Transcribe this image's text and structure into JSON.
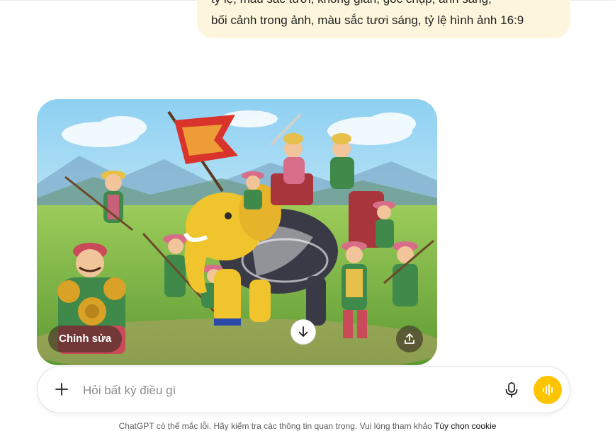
{
  "chat": {
    "user_message_line1": "tỷ lệ, màu sắc tươi, không gian, góc chụp, ánh sáng,",
    "user_message_line2": "bối cảnh trong ảnh, màu sắc tươi sáng, tỷ lệ hình ảnh 16:9"
  },
  "image_actions": {
    "edit_label": "Chỉnh sửa"
  },
  "composer": {
    "placeholder": "Hỏi bất kỳ điều gì"
  },
  "footer": {
    "disclaimer": "ChatGPT có thể mắc lỗi. Hãy kiểm tra các thông tin quan trọng. Vui lòng tham khảo",
    "cookie_link": "Tùy chọn cookie"
  },
  "colors": {
    "user_bubble": "#fdf6dd",
    "voice_button": "#ffc400"
  },
  "icons": [
    "plus-icon",
    "microphone-icon",
    "voice-mode-icon",
    "arrow-down-icon",
    "share-icon"
  ]
}
